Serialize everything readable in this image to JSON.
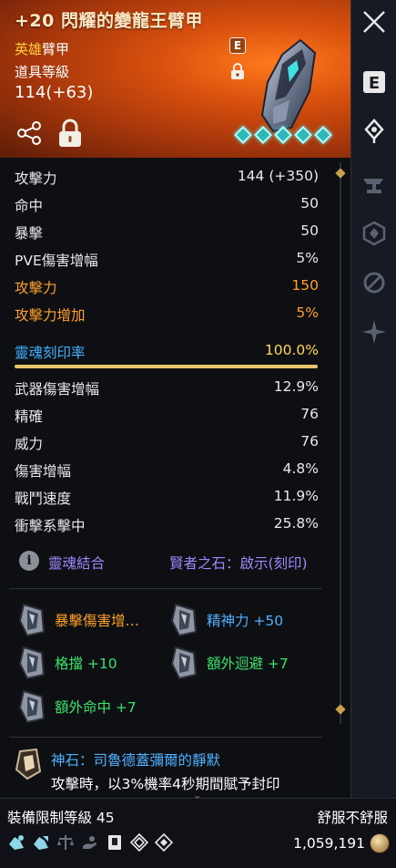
{
  "header": {
    "title": "+20 閃耀的變龍王臂甲",
    "grade_rarity": "英雄",
    "grade_type": "臂甲",
    "item_level_label": "道具等級",
    "item_level_value": "114(+63)",
    "badge_letter": "E"
  },
  "stats": [
    {
      "label": "攻擊力",
      "value": "144 (+350)",
      "color": "white"
    },
    {
      "label": "命中",
      "value": "50",
      "color": "white"
    },
    {
      "label": "暴擊",
      "value": "50",
      "color": "white"
    },
    {
      "label": "PVE傷害增幅",
      "value": "5%",
      "color": "white"
    },
    {
      "label": "攻擊力",
      "value": "150",
      "color": "orange"
    },
    {
      "label": "攻擊力增加",
      "value": "5%",
      "color": "orange"
    }
  ],
  "soul_imprint": {
    "label": "靈魂刻印率",
    "value": "100.0%",
    "progress": 1.0
  },
  "stats2": [
    {
      "label": "武器傷害增幅",
      "value": "12.9%"
    },
    {
      "label": "精確",
      "value": "76"
    },
    {
      "label": "威力",
      "value": "76"
    },
    {
      "label": "傷害增幅",
      "value": "4.8%"
    },
    {
      "label": "戰鬥速度",
      "value": "11.9%"
    },
    {
      "label": "衝擊系擊中",
      "value": "25.8%"
    }
  ],
  "soul_combo": {
    "label": "靈魂結合",
    "value": "賢者之石：啟示(刻印)"
  },
  "effects": [
    {
      "text": "暴擊傷害增…",
      "color": "orange"
    },
    {
      "text": "精神力 +50",
      "color": "blue"
    },
    {
      "text": "格擋 +10",
      "color": "green"
    },
    {
      "text": "額外迴避 +7",
      "color": "green"
    },
    {
      "text": "額外命中 +7",
      "color": "green"
    }
  ],
  "godstone": {
    "name": "神石：司魯德蓋彌爾的靜默",
    "desc": "攻擊時，以3%機率4秒期間賦予封印"
  },
  "footer": {
    "req_level": "裝備限制等級 45",
    "comfort": "舒服不舒服",
    "price": "1,059,191",
    "icons": [
      "soul-gem-icon",
      "soul-gem-2-icon",
      "scale-icon",
      "hand-icon",
      "book-icon",
      "diamond-pattern-icon",
      "diamond-target-icon"
    ]
  },
  "colors": {
    "header_orange": "#d8500e",
    "soul_blue": "#3fb3ff",
    "gold": "#ffd75a",
    "accent_orange": "#ffa028"
  }
}
